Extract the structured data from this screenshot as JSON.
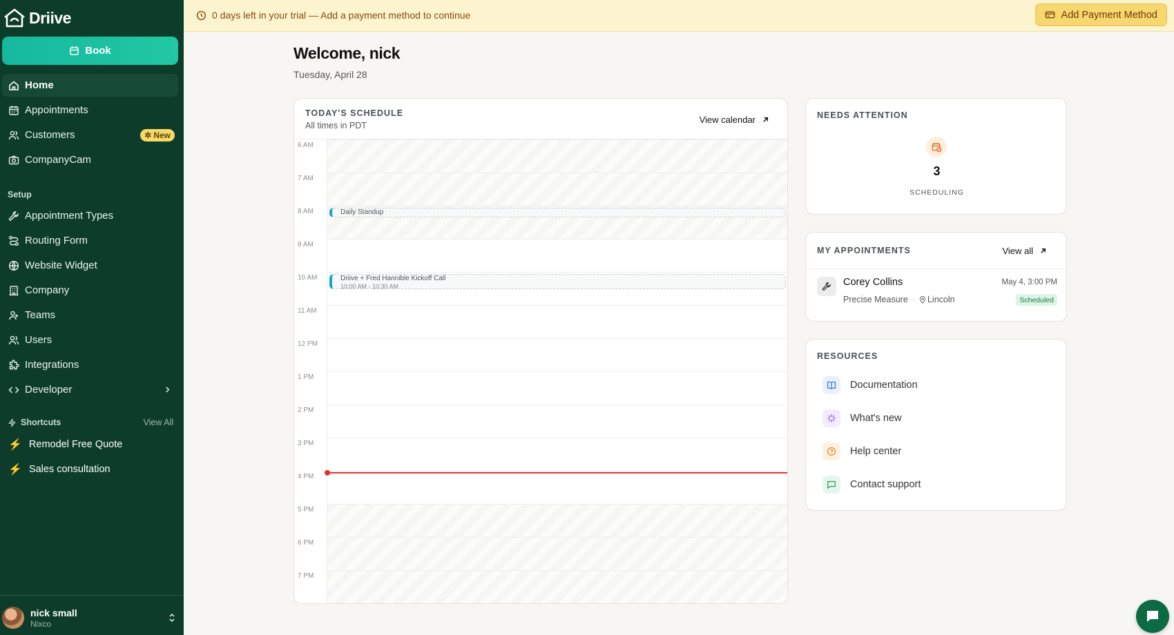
{
  "brand": {
    "name": "Driive"
  },
  "sidebar": {
    "book_label": "Book",
    "main_items": [
      {
        "label": "Home",
        "icon": "home-icon",
        "active": true
      },
      {
        "label": "Appointments",
        "icon": "calendar-icon"
      },
      {
        "label": "Customers",
        "icon": "users-icon",
        "badge": "New"
      },
      {
        "label": "CompanyCam",
        "icon": "camera-icon"
      }
    ],
    "setup_title": "Setup",
    "setup_items": [
      {
        "label": "Appointment Types",
        "icon": "wrench-icon"
      },
      {
        "label": "Routing Form",
        "icon": "routing-icon"
      },
      {
        "label": "Website Widget",
        "icon": "globe-icon"
      },
      {
        "label": "Company",
        "icon": "building-icon"
      },
      {
        "label": "Teams",
        "icon": "teams-icon"
      },
      {
        "label": "Users",
        "icon": "users-icon"
      },
      {
        "label": "Integrations",
        "icon": "puzzle-icon"
      },
      {
        "label": "Developer",
        "icon": "code-icon"
      }
    ],
    "shortcuts_title": "Shortcuts",
    "shortcuts_view_all": "View All",
    "shortcuts": [
      {
        "label": "Remodel Free Quote"
      },
      {
        "label": "Sales consultation"
      }
    ],
    "user": {
      "name": "nick small",
      "org": "Nixco"
    }
  },
  "banner": {
    "text": "0 days left in your trial — Add a payment method to continue",
    "button": "Add Payment Method"
  },
  "header": {
    "welcome": "Welcome, nick",
    "date": "Tuesday, April 28"
  },
  "schedule": {
    "title": "TODAY'S SCHEDULE",
    "subtitle": "All times in PDT",
    "view_calendar": "View calendar",
    "hours": [
      "6 AM",
      "7 AM",
      "8 AM",
      "9 AM",
      "10 AM",
      "11 AM",
      "12 PM",
      "1 PM",
      "2 PM",
      "3 PM",
      "4 PM",
      "5 PM",
      "6 PM",
      "7 PM"
    ],
    "off_hours": [
      "6 AM",
      "7 AM",
      "8 AM",
      "5 PM",
      "6 PM",
      "7 PM"
    ],
    "events": [
      {
        "title": "Daily Standup",
        "time": "",
        "start_hour": 8.0,
        "end_hour": 8.25,
        "color": "#14a8c8"
      },
      {
        "title": "Driive + Fred Hannible Kickoff Call",
        "time": "10:00 AM - 10:30 AM",
        "start_hour": 10.0,
        "end_hour": 10.5,
        "color": "#14a8c8"
      }
    ],
    "now_hour": 16.0
  },
  "attention": {
    "title": "NEEDS ATTENTION",
    "count": "3",
    "label": "SCHEDULING"
  },
  "my_appointments": {
    "title": "MY APPOINTMENTS",
    "view_all": "View all",
    "items": [
      {
        "name": "Corey Collins",
        "type": "Precise Measure",
        "location": "Lincoln",
        "when": "May 4, 3:00 PM",
        "status": "Scheduled"
      }
    ]
  },
  "resources": {
    "title": "RESOURCES",
    "items": [
      {
        "label": "Documentation",
        "icon": "book-icon",
        "color": "#3b73d9",
        "bg": "#eaf1fd"
      },
      {
        "label": "What's new",
        "icon": "sparkle-icon",
        "color": "#8a4fd6",
        "bg": "#f3ecfd"
      },
      {
        "label": "Help center",
        "icon": "help-circle-icon",
        "color": "#e08a14",
        "bg": "#fdf1e2"
      },
      {
        "label": "Contact support",
        "icon": "message-icon",
        "color": "#2e9a57",
        "bg": "#e6f6ec"
      }
    ]
  },
  "colors": {
    "sidebar_bg": "#0d3d2a",
    "accent": "#16b99e",
    "banner_bg": "#fcf3cf",
    "now_line": "#e03131"
  }
}
